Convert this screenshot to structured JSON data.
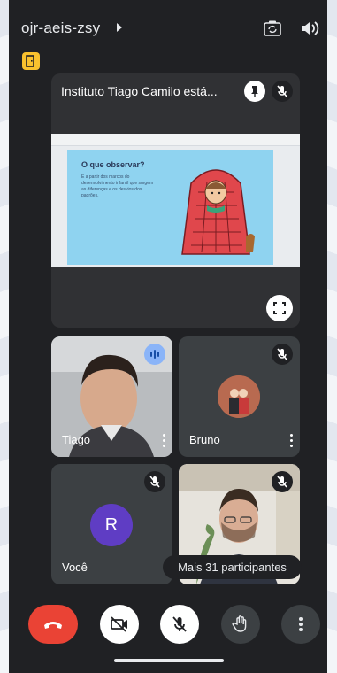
{
  "meeting": {
    "code": "ojr-aeis-zsy"
  },
  "main_tile": {
    "title": "Instituto Tiago Camilo está...",
    "slide": {
      "heading": "O que observar?",
      "body": "É a partir dos marcos do desenvolvimento infantil que surgem as diferenças e os desvios dos padrões."
    }
  },
  "participants": [
    {
      "name": "Tiago",
      "state": "speaking"
    },
    {
      "name": "Bruno",
      "state": "muted"
    },
    {
      "name": "Você",
      "avatar_letter": "R",
      "state": "muted"
    },
    {
      "name": "",
      "state": "muted"
    }
  ],
  "more_participants": "Mais 31 participantes",
  "controls": [
    {
      "icon": "end-call-icon"
    },
    {
      "icon": "camera-off-icon"
    },
    {
      "icon": "mic-off-icon"
    },
    {
      "icon": "raise-hand-icon"
    },
    {
      "icon": "more-vertical-icon"
    }
  ],
  "colors": {
    "background": "#202124",
    "tile": "#3c4043",
    "end_call": "#ea4335",
    "exit_badge": "#f9c12e",
    "speaking": "#8ab4f8",
    "avatar_r": "#5f3dc4"
  }
}
